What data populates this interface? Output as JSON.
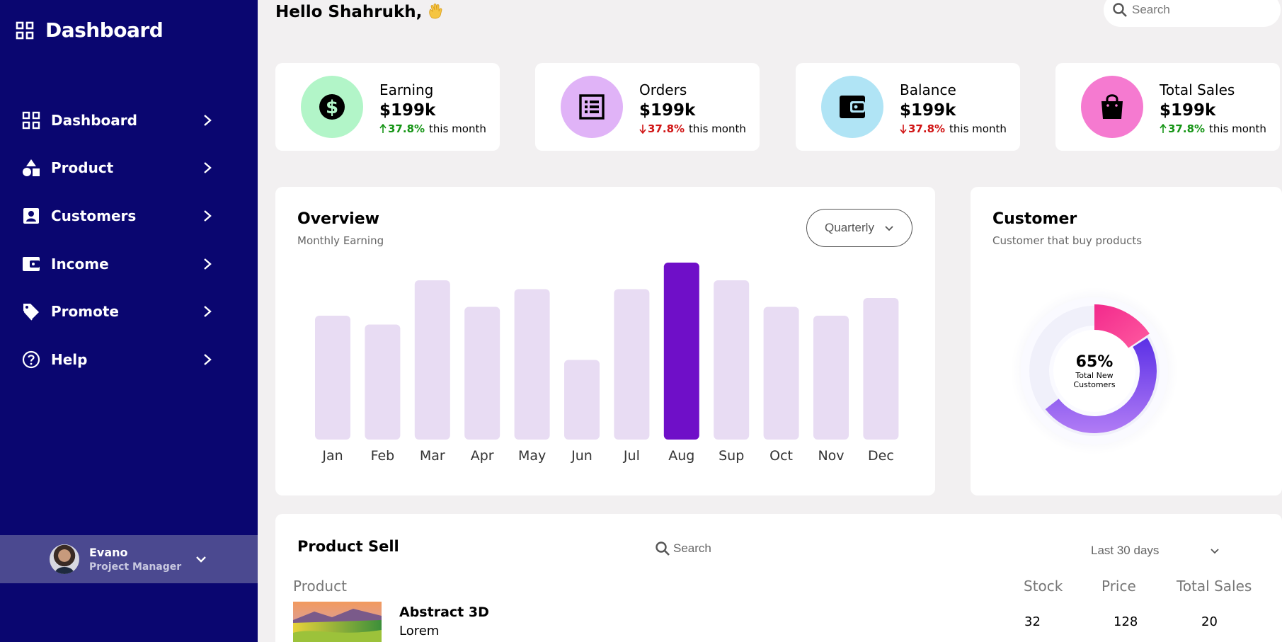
{
  "sidebar": {
    "title": "Dashboard",
    "items": [
      {
        "label": "Dashboard",
        "icon": "grid-icon"
      },
      {
        "label": "Product",
        "icon": "shapes-icon"
      },
      {
        "label": "Customers",
        "icon": "contact-card-icon"
      },
      {
        "label": "Income",
        "icon": "wallet-icon"
      },
      {
        "label": "Promote",
        "icon": "tag-icon"
      },
      {
        "label": "Help",
        "icon": "help-circle-icon"
      }
    ],
    "user": {
      "name": "Evano",
      "role": "Project Manager"
    }
  },
  "header": {
    "greeting": "Hello Shahrukh,",
    "search_placeholder": "Search"
  },
  "stats": [
    {
      "label": "Earning",
      "value": "$199k",
      "change": "37.8%",
      "direction": "up",
      "suffix": "this month",
      "icon": "dollar-icon",
      "color": "#b2f5c8"
    },
    {
      "label": "Orders",
      "value": "$199k",
      "change": "37.8%",
      "direction": "down",
      "suffix": "this month",
      "icon": "list-icon",
      "color": "#e0b3f7"
    },
    {
      "label": "Balance",
      "value": "$199k",
      "change": "37.8%",
      "direction": "down",
      "suffix": "this month",
      "icon": "wallet-icon",
      "color": "#b0e4f5"
    },
    {
      "label": "Total Sales",
      "value": "$199k",
      "change": "37.8%",
      "direction": "up",
      "suffix": "this month",
      "icon": "shopping-bag-icon",
      "color": "#f57ad0"
    }
  ],
  "overview": {
    "title": "Overview",
    "subtitle": "Monthly Earning",
    "period": "Quarterly"
  },
  "chart_data": {
    "type": "bar",
    "categories": [
      "Jan",
      "Feb",
      "Mar",
      "Apr",
      "May",
      "Jun",
      "Jul",
      "Aug",
      "Sup",
      "Oct",
      "Nov",
      "Dec"
    ],
    "values": [
      70,
      65,
      90,
      75,
      85,
      45,
      85,
      100,
      90,
      75,
      70,
      80
    ],
    "highlight": "Aug",
    "colors": {
      "bar": "#e8dcf3",
      "highlight": "#6f0fc8"
    },
    "title": "",
    "xlabel": "",
    "ylabel": "",
    "ylim": [
      0,
      100
    ]
  },
  "customer": {
    "title": "Customer",
    "subtitle": "Customer that buy products",
    "percent": "65%",
    "label": "Total New Customers",
    "value": 65
  },
  "product_sell": {
    "title": "Product Sell",
    "search_placeholder": "Search",
    "range": "Last 30 days",
    "columns": {
      "product": "Product",
      "stock": "Stock",
      "price": "Price",
      "total_sales": "Total Sales"
    },
    "rows": [
      {
        "name": "Abstract 3D",
        "sub": "Lorem",
        "stock": "32",
        "price": "128",
        "total_sales": "20"
      }
    ]
  }
}
